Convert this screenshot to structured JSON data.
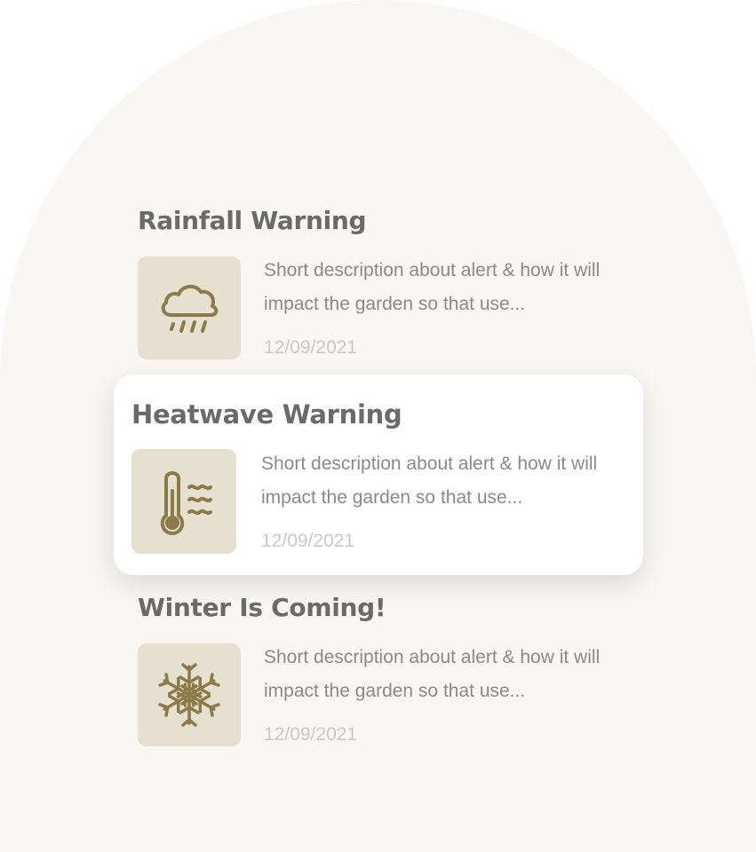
{
  "alerts": [
    {
      "title": "Rainfall Warning",
      "icon": "rain-cloud-icon",
      "description": "Short description about alert & how it will impact the garden so that use...",
      "date": "12/09/2021",
      "highlighted": false
    },
    {
      "title": "Heatwave Warning",
      "icon": "thermometer-heat-icon",
      "description": "Short description about alert & how it will impact the garden so that use...",
      "date": "12/09/2021",
      "highlighted": true
    },
    {
      "title": "Winter Is Coming!",
      "icon": "snowflake-icon",
      "description": "Short description about alert & how it will impact the garden so that use...",
      "date": "12/09/2021",
      "highlighted": false
    }
  ],
  "colors": {
    "background_arch": "#f8f7f4",
    "icon_tile": "#e5e0d0",
    "icon_stroke": "#8c7a4a",
    "title_text": "#6a6a6a",
    "description_text": "#8a8a8a",
    "date_text": "#c9c9c9",
    "card_background": "#ffffff"
  }
}
